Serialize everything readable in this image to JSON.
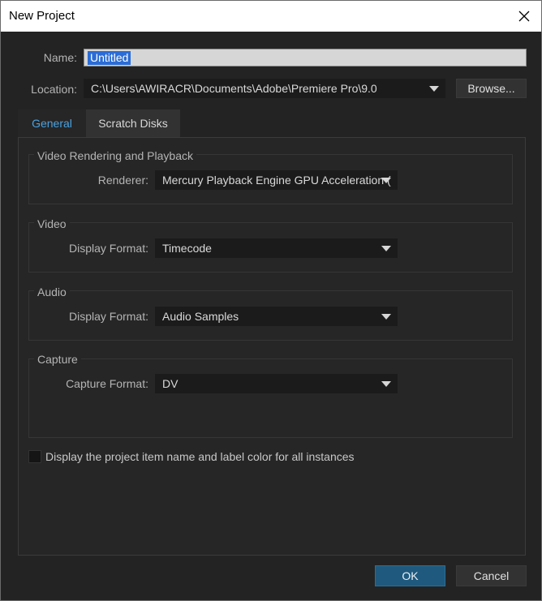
{
  "window": {
    "title": "New Project"
  },
  "form": {
    "name_label": "Name:",
    "name_value": "Untitled",
    "location_label": "Location:",
    "location_value": "C:\\Users\\AWIRACR\\Documents\\Adobe\\Premiere Pro\\9.0",
    "browse_label": "Browse..."
  },
  "tabs": [
    {
      "label": "General",
      "active": true
    },
    {
      "label": "Scratch Disks",
      "active": false
    }
  ],
  "groups": {
    "rendering": {
      "title": "Video Rendering and Playback",
      "field_label": "Renderer:",
      "value": "Mercury Playback Engine GPU Acceleration ("
    },
    "video": {
      "title": "Video",
      "field_label": "Display Format:",
      "value": "Timecode"
    },
    "audio": {
      "title": "Audio",
      "field_label": "Display Format:",
      "value": "Audio Samples"
    },
    "capture": {
      "title": "Capture",
      "field_label": "Capture Format:",
      "value": "DV"
    }
  },
  "checkbox": {
    "label": "Display the project item name and label color for all instances",
    "checked": false
  },
  "footer": {
    "ok_label": "OK",
    "cancel_label": "Cancel"
  },
  "icons": {
    "close": "close-icon",
    "dropdown": "chevron-down-icon"
  },
  "colors": {
    "accent": "#4aa2e0",
    "ok_button": "#1f5a7e",
    "selection": "#2b6cd6"
  }
}
